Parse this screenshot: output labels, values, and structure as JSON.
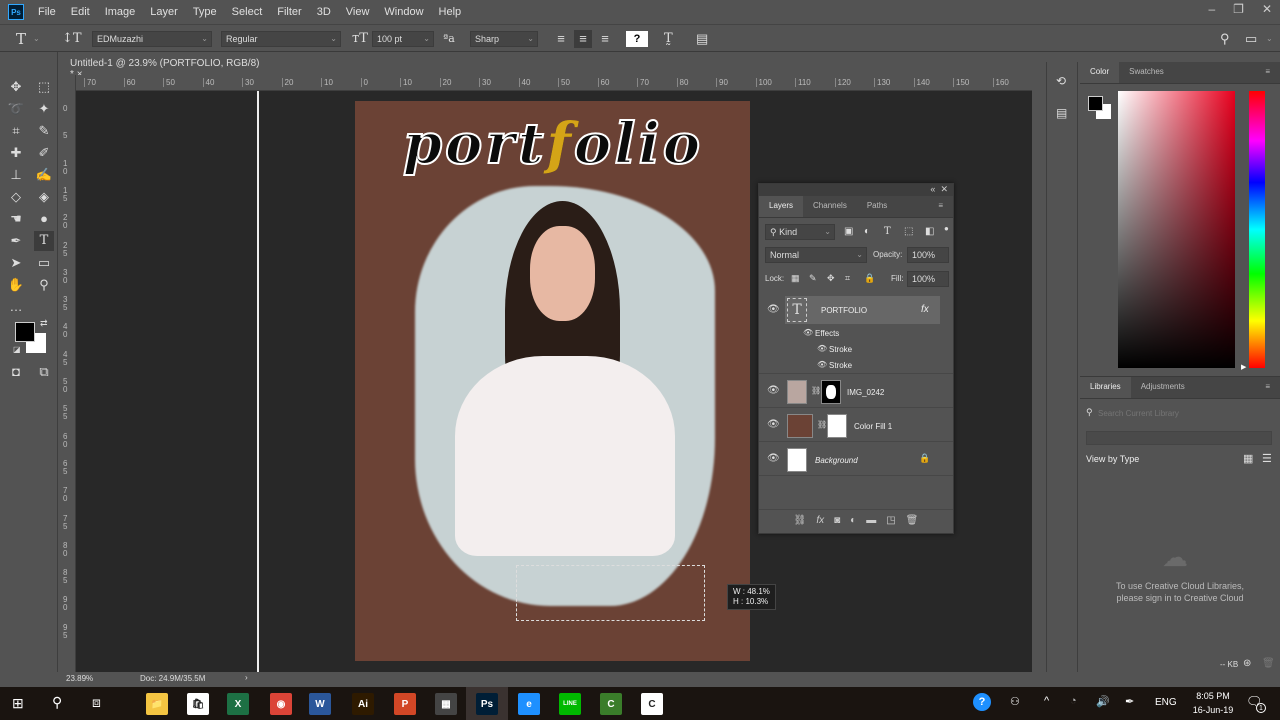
{
  "app": {
    "logo": "Ps",
    "name": "Photoshop"
  },
  "menu": [
    "File",
    "Edit",
    "Image",
    "Layer",
    "Type",
    "Select",
    "Filter",
    "3D",
    "View",
    "Window",
    "Help"
  ],
  "window_controls": {
    "minimize": "–",
    "restore": "❐",
    "close": "✕"
  },
  "options_bar": {
    "font_family": "EDMuzazhi",
    "font_style": "Regular",
    "font_size": "100 pt",
    "anti_alias": "Sharp",
    "warp_label": "?"
  },
  "document": {
    "tab_title": "Untitled-1 @ 23.9% (PORTFOLIO, RGB/8) *",
    "close": "×",
    "canvas_title_prefix": "port",
    "canvas_title_accent": "f",
    "canvas_title_suffix": "olio",
    "canvas_bg": "#6b4235",
    "accent_color": "#d4a417",
    "transform_tip_w": "W : 48.1%",
    "transform_tip_h": "H : 10.3%",
    "zoom": "23.89%",
    "doc_size": "Doc: 24.9M/35.5M",
    "hruler_labels": [
      "70",
      "60",
      "50",
      "40",
      "30",
      "20",
      "10",
      "0",
      "10",
      "20",
      "30",
      "40",
      "50",
      "60",
      "70",
      "80",
      "90",
      "100",
      "110",
      "120",
      "130",
      "140",
      "150",
      "160"
    ],
    "vruler_labels": [
      "0",
      "5",
      "10",
      "15",
      "20",
      "25",
      "30",
      "35",
      "40",
      "45",
      "50",
      "55",
      "60",
      "65",
      "70",
      "75",
      "80",
      "85",
      "90",
      "95"
    ]
  },
  "layers_panel": {
    "tabs": [
      "Layers",
      "Channels",
      "Paths"
    ],
    "filter_label": "Kind",
    "blend_mode": "Normal",
    "opacity_label": "Opacity:",
    "opacity_value": "100%",
    "lock_label": "Lock:",
    "fill_label": "Fill:",
    "fill_value": "100%",
    "layers": [
      {
        "name": "PORTFOLIO",
        "type": "text",
        "fx": "fx"
      },
      {
        "name": "IMG_0242",
        "type": "image"
      },
      {
        "name": "Color Fill 1",
        "type": "fill"
      },
      {
        "name": "Background",
        "type": "background"
      }
    ],
    "effects_label": "Effects",
    "effects": [
      "Stroke",
      "Stroke"
    ]
  },
  "color_panel": {
    "tabs": [
      "Color",
      "Swatches"
    ],
    "hue_color": "#e8001e"
  },
  "libraries_panel": {
    "tabs": [
      "Libraries",
      "Adjustments"
    ],
    "search_placeholder": "Search Current Library",
    "view_by": "View by Type",
    "message_line1": "To use Creative Cloud Libraries,",
    "message_line2": "please sign in to Creative Cloud",
    "size": "-- KB"
  },
  "taskbar": {
    "apps": [
      {
        "name": "File Explorer",
        "label": "📁",
        "color": "#f4c542"
      },
      {
        "name": "Store",
        "label": "🛍",
        "color": "#ffffff"
      },
      {
        "name": "Excel",
        "label": "X",
        "color": "#1d7044"
      },
      {
        "name": "Chrome",
        "label": "◉",
        "color": "#db4437"
      },
      {
        "name": "Word",
        "label": "W",
        "color": "#2b579a"
      },
      {
        "name": "Illustrator",
        "label": "Ai",
        "color": "#2e1a00"
      },
      {
        "name": "PowerPoint",
        "label": "P",
        "color": "#d24726"
      },
      {
        "name": "Calculator",
        "label": "▦",
        "color": "#444444"
      },
      {
        "name": "Photoshop",
        "label": "Ps",
        "color": "#001e36"
      },
      {
        "name": "Internet Explorer",
        "label": "e",
        "color": "#1e90ff"
      },
      {
        "name": "LINE",
        "label": "LINE",
        "color": "#00b900"
      },
      {
        "name": "Camtasia",
        "label": "C",
        "color": "#3a7d2a"
      },
      {
        "name": "Camtasia Recorder",
        "label": "C",
        "color": "#ffffff"
      }
    ],
    "language": "ENG",
    "time": "8:05 PM",
    "date": "16-Jun-19",
    "notifications": "1"
  }
}
